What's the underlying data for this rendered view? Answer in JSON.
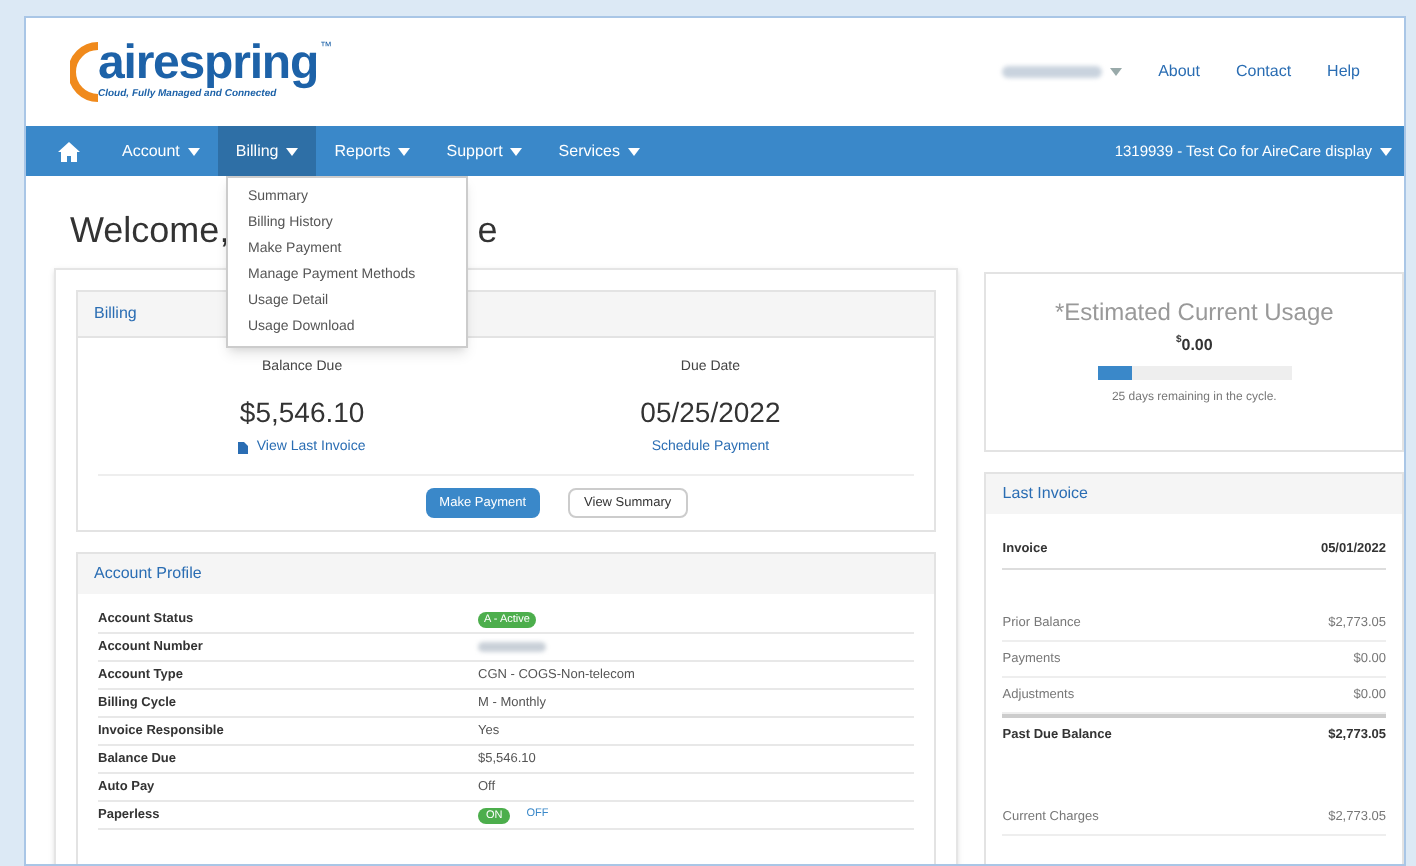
{
  "logo": {
    "name": "airespring",
    "trademark": "™",
    "tagline": "Cloud, Fully Managed and Connected"
  },
  "top_links": [
    "About",
    "Contact",
    "Help"
  ],
  "nav": {
    "items": [
      {
        "label": "Account",
        "selected": false
      },
      {
        "label": "Billing",
        "selected": true
      },
      {
        "label": "Reports",
        "selected": false
      },
      {
        "label": "Support",
        "selected": false
      },
      {
        "label": "Services",
        "selected": false
      }
    ],
    "account_selector": "1319939 - Test Co for AireCare display"
  },
  "billing_menu": [
    "Summary",
    "Billing History",
    "Make Payment",
    "Manage Payment Methods",
    "Usage Detail",
    "Usage Download"
  ],
  "welcome": {
    "heading": "Welcome,",
    "tail": "e"
  },
  "billing": {
    "title": "Billing",
    "balance_label": "Balance Due",
    "balance": "$5,546.10",
    "invoice_link": "View Last Invoice",
    "due_label": "Due Date",
    "due_date": "05/25/2022",
    "schedule_link": "Schedule Payment",
    "pay_button": "Make Payment",
    "summary_button": "View Summary"
  },
  "usage": {
    "title": "*Estimated Current Usage",
    "currency": "$",
    "amount": "0.00",
    "level": 0.18,
    "note": "25 days remaining in the cycle."
  },
  "profile": {
    "title": "Account Profile",
    "rows": [
      {
        "label": "Account Status",
        "kind": "badge",
        "value": "A - Active"
      },
      {
        "label": "Account Number",
        "kind": "redacted"
      },
      {
        "label": "Account Type",
        "kind": "text",
        "value": "CGN - COGS-Non-telecom"
      },
      {
        "label": "Billing Cycle",
        "kind": "text",
        "value": "M - Monthly"
      },
      {
        "label": "Invoice Responsible",
        "kind": "text",
        "value": "Yes"
      },
      {
        "label": "Balance Due",
        "kind": "text",
        "value": "$5,546.10"
      },
      {
        "label": "Auto Pay",
        "kind": "text",
        "value": "Off"
      },
      {
        "label": "Paperless",
        "kind": "toggle",
        "on_label": "ON",
        "off_label": "OFF",
        "on": true
      }
    ]
  },
  "last_invoice": {
    "title": "Last Invoice",
    "rows": [
      {
        "kind": "header",
        "label": "Invoice",
        "value": "05/01/2022"
      },
      {
        "kind": "item",
        "label": "Prior Balance",
        "value": "$2,773.05"
      },
      {
        "kind": "item",
        "label": "Payments",
        "value": "$0.00"
      },
      {
        "kind": "item",
        "label": "Adjustments",
        "value": "$0.00"
      },
      {
        "kind": "total",
        "label": "Past Due Balance",
        "value": "$2,773.05"
      },
      {
        "kind": "item",
        "label": "Current Charges",
        "value": "$2,773.05"
      }
    ]
  }
}
